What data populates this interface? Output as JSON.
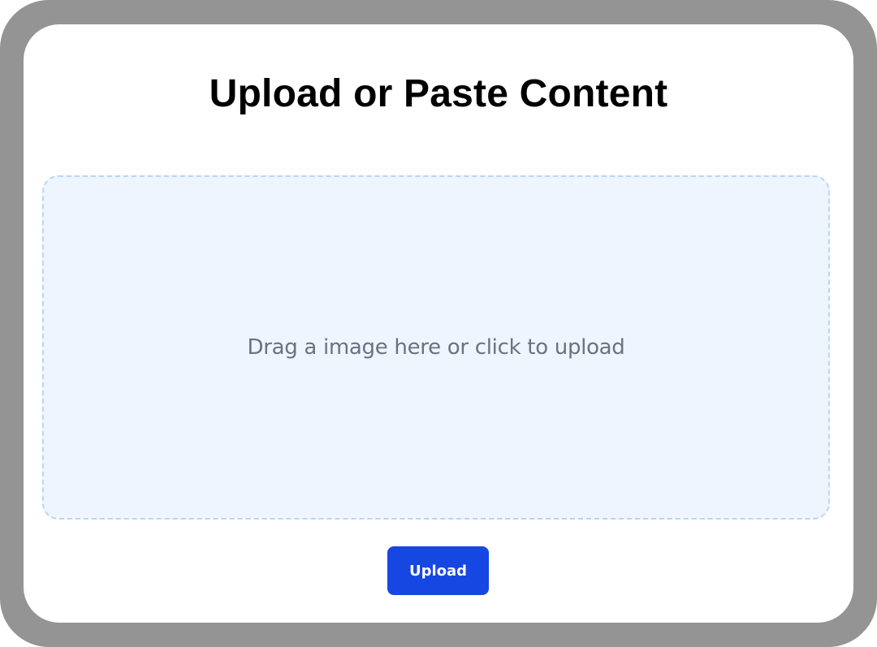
{
  "page": {
    "title": "Upload or Paste Content"
  },
  "dropzone": {
    "prompt": "Drag a image here or click to upload"
  },
  "actions": {
    "upload_label": "Upload"
  },
  "colors": {
    "frame": "#949494",
    "card": "#ffffff",
    "dropzone_bg": "#eef5ff",
    "dropzone_border": "#b7d6f6",
    "button": "#1747e3",
    "prompt_text": "#6a7280"
  }
}
